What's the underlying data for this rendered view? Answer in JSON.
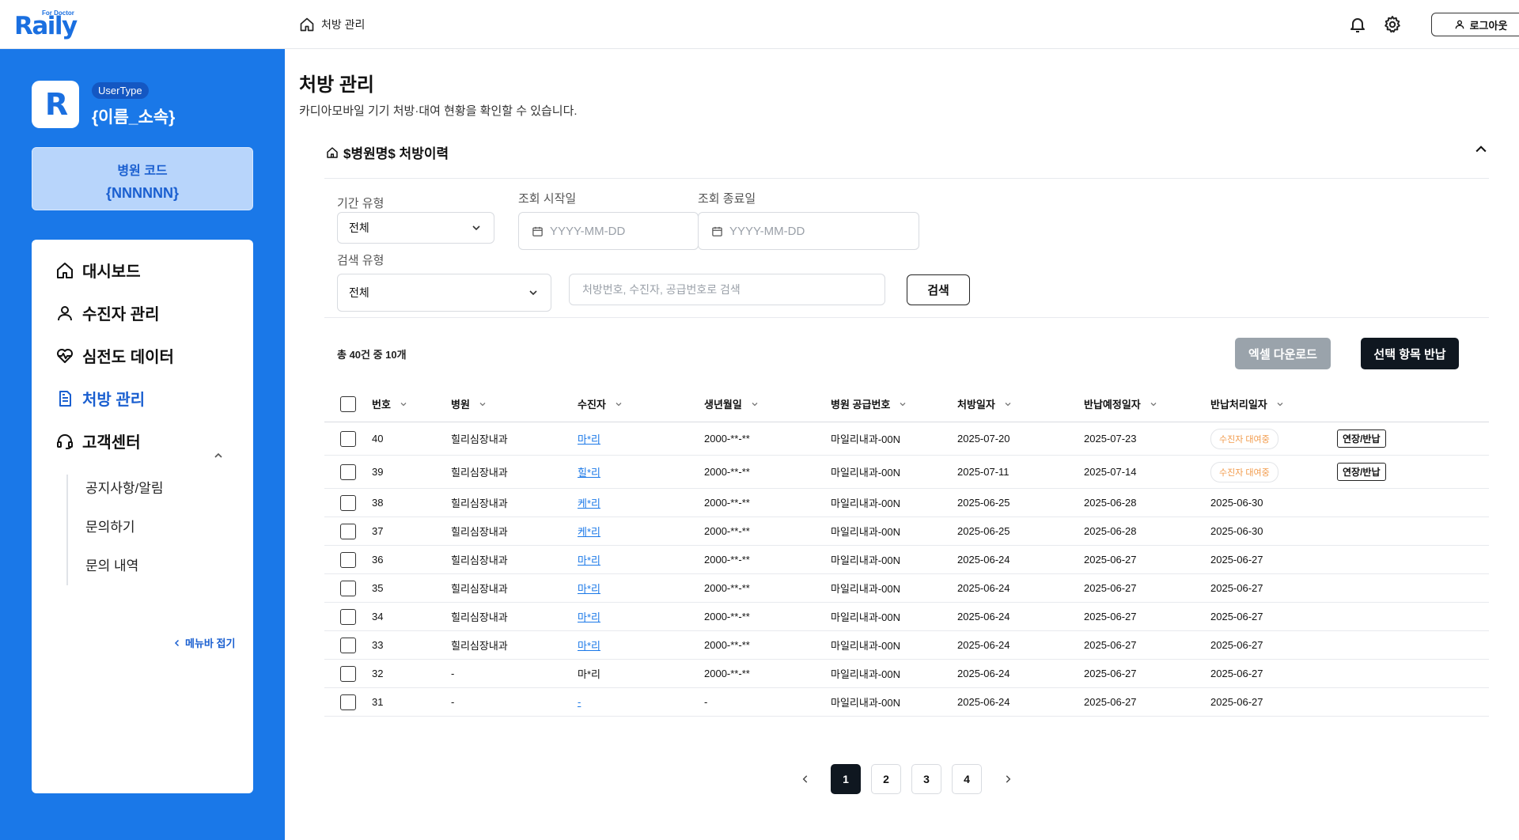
{
  "brand": {
    "logo_text": "Raily",
    "logo_sub": "For Doctor"
  },
  "header": {
    "breadcrumb": "처방 관리",
    "logout_label": "로그아웃"
  },
  "profile": {
    "usertype": "UserType",
    "name": "{이름_소속}"
  },
  "hospital": {
    "label": "병원 코드",
    "code": "{NNNNNN}"
  },
  "nav": {
    "items": [
      {
        "label": "대시보드",
        "icon": "home-icon"
      },
      {
        "label": "수진자 관리",
        "icon": "user-icon"
      },
      {
        "label": "심전도 데이터",
        "icon": "heart-pulse-icon"
      },
      {
        "label": "처방 관리",
        "icon": "document-icon",
        "active": true
      },
      {
        "label": "고객센터",
        "icon": "headset-icon"
      }
    ],
    "sub_items": [
      "공지사항/알림",
      "문의하기",
      "문의 내역"
    ],
    "collapse_label": "메뉴바 접기"
  },
  "page": {
    "title": "처방 관리",
    "description": "카디아모바일 기기 처방·대여 현황을 확인할 수 있습니다."
  },
  "section": {
    "title": "$병원명$ 처방이력"
  },
  "filters": {
    "period_type_label": "기간 유형",
    "period_type_value": "전체",
    "start_label": "조회 시작일",
    "start_placeholder": "YYYY-MM-DD",
    "end_label": "조회 종료일",
    "end_placeholder": "YYYY-MM-DD",
    "search_type_label": "검색 유형",
    "search_type_value": "전체",
    "search_placeholder": "처방번호, 수진자, 공급번호로 검색",
    "search_button": "검색"
  },
  "table": {
    "total_text": "총 40건 중 10개",
    "excel_button": "엑셀 다운로드",
    "return_button": "선택 항목 반납",
    "columns": [
      "번호",
      "병원",
      "수진자",
      "생년월일",
      "병원 공급번호",
      "처방일자",
      "반납예정일자",
      "반납처리일자"
    ],
    "rows": [
      {
        "no": "40",
        "hospital": "힐리심장내과",
        "patient": "마*리",
        "patient_link": true,
        "birth": "2000-**-**",
        "supply": "마일리내과-00N",
        "rx_date": "2025-07-20",
        "due_date": "2025-07-23",
        "return_date": "",
        "status": "수진자 대여중",
        "action": "연장/반납"
      },
      {
        "no": "39",
        "hospital": "힐리심장내과",
        "patient": "힐*리",
        "patient_link": true,
        "birth": "2000-**-**",
        "supply": "마일리내과-00N",
        "rx_date": "2025-07-11",
        "due_date": "2025-07-14",
        "return_date": "",
        "status": "수진자 대여중",
        "action": "연장/반납"
      },
      {
        "no": "38",
        "hospital": "힐리심장내과",
        "patient": "케*리",
        "patient_link": true,
        "birth": "2000-**-**",
        "supply": "마일리내과-00N",
        "rx_date": "2025-06-25",
        "due_date": "2025-06-28",
        "return_date": "2025-06-30",
        "status": "",
        "action": ""
      },
      {
        "no": "37",
        "hospital": "힐리심장내과",
        "patient": "케*리",
        "patient_link": true,
        "birth": "2000-**-**",
        "supply": "마일리내과-00N",
        "rx_date": "2025-06-25",
        "due_date": "2025-06-28",
        "return_date": "2025-06-30",
        "status": "",
        "action": ""
      },
      {
        "no": "36",
        "hospital": "힐리심장내과",
        "patient": "마*리",
        "patient_link": true,
        "birth": "2000-**-**",
        "supply": "마일리내과-00N",
        "rx_date": "2025-06-24",
        "due_date": "2025-06-27",
        "return_date": "2025-06-27",
        "status": "",
        "action": ""
      },
      {
        "no": "35",
        "hospital": "힐리심장내과",
        "patient": "마*리",
        "patient_link": true,
        "birth": "2000-**-**",
        "supply": "마일리내과-00N",
        "rx_date": "2025-06-24",
        "due_date": "2025-06-27",
        "return_date": "2025-06-27",
        "status": "",
        "action": ""
      },
      {
        "no": "34",
        "hospital": "힐리심장내과",
        "patient": "마*리",
        "patient_link": true,
        "birth": "2000-**-**",
        "supply": "마일리내과-00N",
        "rx_date": "2025-06-24",
        "due_date": "2025-06-27",
        "return_date": "2025-06-27",
        "status": "",
        "action": ""
      },
      {
        "no": "33",
        "hospital": "힐리심장내과",
        "patient": "마*리",
        "patient_link": true,
        "birth": "2000-**-**",
        "supply": "마일리내과-00N",
        "rx_date": "2025-06-24",
        "due_date": "2025-06-27",
        "return_date": "2025-06-27",
        "status": "",
        "action": ""
      },
      {
        "no": "32",
        "hospital": "-",
        "patient": "마*리",
        "patient_link": false,
        "birth": "2000-**-**",
        "supply": "마일리내과-00N",
        "rx_date": "2025-06-24",
        "due_date": "2025-06-27",
        "return_date": "2025-06-27",
        "status": "",
        "action": ""
      },
      {
        "no": "31",
        "hospital": "-",
        "patient": "-",
        "patient_link": true,
        "birth": "-",
        "supply": "마일리내과-00N",
        "rx_date": "2025-06-24",
        "due_date": "2025-06-27",
        "return_date": "2025-06-27",
        "status": "",
        "action": ""
      }
    ]
  },
  "pagination": {
    "pages": [
      "1",
      "2",
      "3",
      "4"
    ],
    "current": "1"
  },
  "colors": {
    "brand_blue": "#1a78e8",
    "dark": "#0f1720",
    "status_orange": "#f29a4a",
    "muted_button": "#9aa3ab"
  }
}
